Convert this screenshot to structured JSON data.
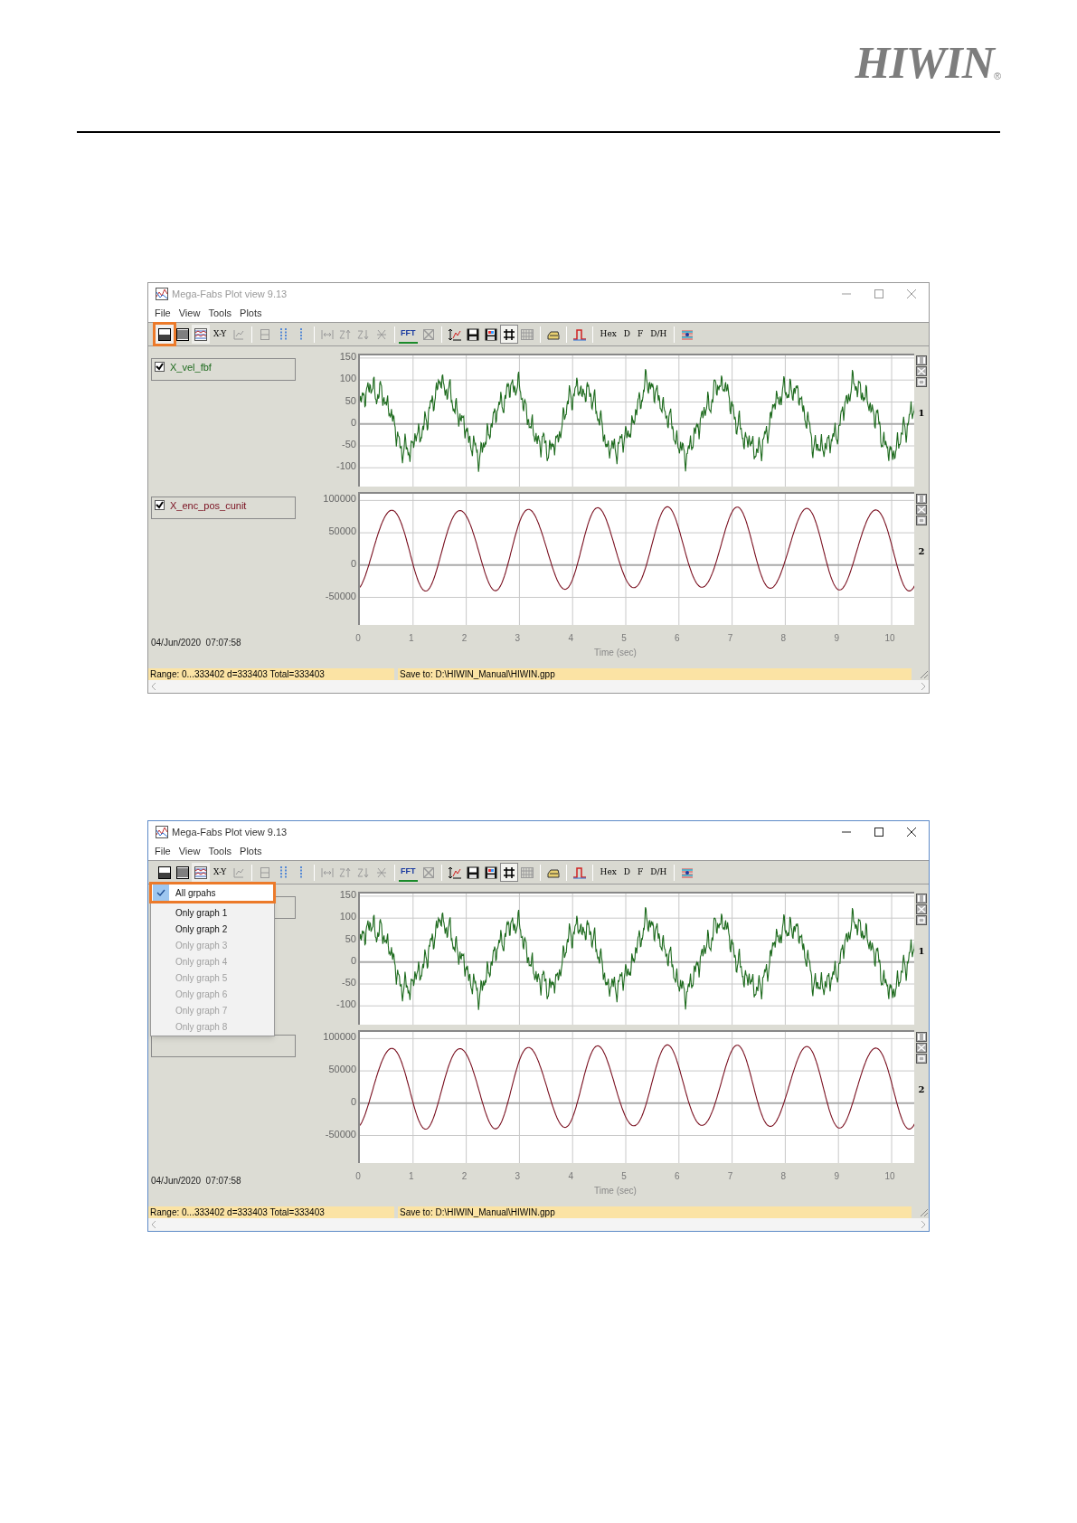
{
  "header": {
    "logo": "HIWIN",
    "mark": "®"
  },
  "windows": [
    {
      "title": "Mega-Fabs Plot view 9.13",
      "active": false,
      "menu": [
        "File",
        "View",
        "Tools",
        "Plots"
      ],
      "toolbar": {
        "texts": [
          "X-Y",
          "FFT",
          "Hex",
          "D",
          "F",
          "D/H"
        ],
        "first_highlighted": true,
        "grid_pressed": true
      },
      "graphs": [
        {
          "kind": "velocity",
          "signal": "X_vel_fbf",
          "checked": true,
          "color": "#1e6b1e",
          "number": "1",
          "yticks": [
            "150",
            "100",
            "50",
            "0",
            "-50",
            "-100"
          ]
        },
        {
          "kind": "position",
          "signal": "X_enc_pos_cunit",
          "checked": true,
          "color": "#7a1020",
          "number": "2",
          "yticks": [
            "100000",
            "50000",
            "0",
            "-50000"
          ]
        }
      ],
      "xticks": [
        "0",
        "1",
        "2",
        "3",
        "4",
        "5",
        "6",
        "7",
        "8",
        "9",
        "10"
      ],
      "xlabel": "Time (sec)",
      "timestamp": "04/Jun/2020  07:07:58",
      "status": [
        "Range: 0...333402 d=333403 Total=333403",
        "Save to: D:\\HIWIN_Manual\\HIWIN.gpp"
      ]
    },
    {
      "title": "Mega-Fabs Plot view 9.13",
      "active": true,
      "menu": [
        "File",
        "View",
        "Tools",
        "Plots"
      ],
      "toolbar": {
        "texts": [
          "X-Y",
          "FFT",
          "Hex",
          "D",
          "F",
          "D/H"
        ],
        "first_highlighted": false,
        "grid_pressed": true
      },
      "graphs": [
        {
          "kind": "velocity",
          "color": "#1e6b1e",
          "number": "1",
          "yticks": [
            "150",
            "100",
            "50",
            "0",
            "-50",
            "-100"
          ]
        },
        {
          "kind": "position",
          "color": "#7a1020",
          "number": "2",
          "yticks": [
            "100000",
            "50000",
            "0",
            "-50000"
          ]
        }
      ],
      "xticks": [
        "0",
        "1",
        "2",
        "3",
        "4",
        "5",
        "6",
        "7",
        "8",
        "9",
        "10"
      ],
      "xlabel": "Time (sec)",
      "timestamp": "04/Jun/2020  07:07:58",
      "status": [
        "Range: 0...333402 d=333403 Total=333403",
        "Save to: D:\\HIWIN_Manual\\HIWIN.gpp"
      ],
      "dropdown": {
        "items": [
          {
            "label": "All grpahs",
            "checked": true,
            "disabled": false,
            "highlighted": true
          },
          {
            "label": "Only graph 1",
            "checked": false,
            "disabled": false,
            "highlighted": false
          },
          {
            "label": "Only graph 2",
            "checked": false,
            "disabled": false,
            "highlighted": false
          },
          {
            "label": "Only graph 3",
            "checked": false,
            "disabled": true,
            "highlighted": false
          },
          {
            "label": "Only graph 4",
            "checked": false,
            "disabled": true,
            "highlighted": false
          },
          {
            "label": "Only graph 5",
            "checked": false,
            "disabled": true,
            "highlighted": false
          },
          {
            "label": "Only graph 6",
            "checked": false,
            "disabled": true,
            "highlighted": false
          },
          {
            "label": "Only graph 7",
            "checked": false,
            "disabled": true,
            "highlighted": false
          },
          {
            "label": "Only graph 8",
            "checked": false,
            "disabled": true,
            "highlighted": false
          }
        ]
      }
    }
  ]
}
